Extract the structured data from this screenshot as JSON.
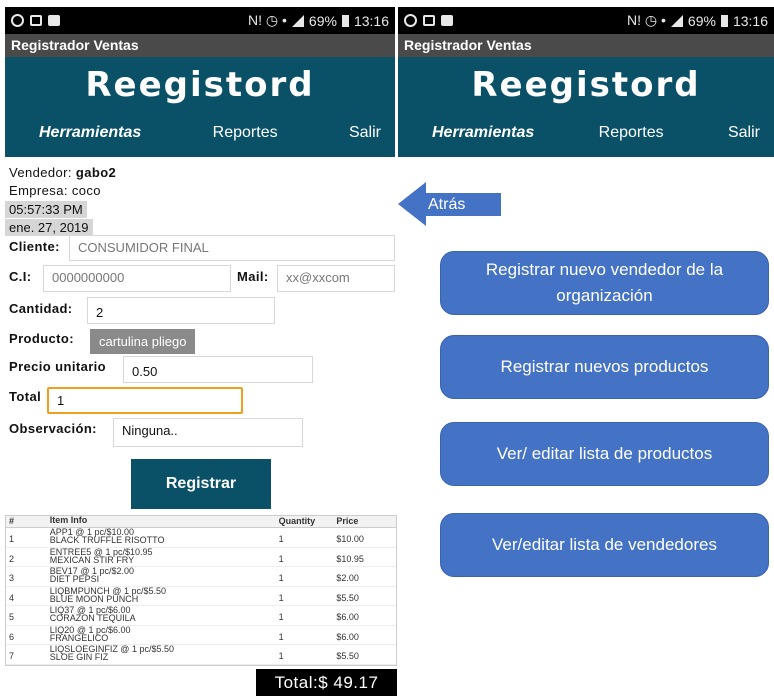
{
  "status": {
    "left_icons": [
      "whatsapp-icon",
      "gallery-icon",
      "mail-icon"
    ],
    "right_icons": "N! ◷ •",
    "battery": "69%",
    "time": "13:16"
  },
  "app": {
    "name": "Registrador Ventas",
    "title": "Reegistord"
  },
  "nav": [
    "Herramientas",
    "Reportes",
    "Salir"
  ],
  "form": {
    "vendedor_label": "Vendedor:",
    "vendedor": "gabo2",
    "empresa": "Empresa: coco",
    "time": "05:57:33 PM",
    "date": "ene. 27, 2019",
    "cliente_label": "Cliente:",
    "cliente": "CONSUMIDOR FINAL",
    "ci_label": "C.I:",
    "ci": "0000000000",
    "mail_label": "Mail:",
    "mail": "xx@xxcom",
    "cantidad_label": "Cantidad:",
    "cantidad": "2",
    "producto_label": "Producto:",
    "producto": "cartulina pliego",
    "precio_label": "Precio unitario",
    "precio": "0.50",
    "total_label": "Total",
    "total": "1",
    "obs_label": "Observación:",
    "obs": "Ninguna..",
    "submit": "Registrar"
  },
  "receipt": {
    "headers": [
      "#",
      "Item Info",
      "Quantity",
      "Price"
    ],
    "rows": [
      [
        "1",
        "APP1 @ 1 pc/$10.00",
        "BLACK TRUFFLE RISOTTO",
        "1",
        "$10.00"
      ],
      [
        "2",
        "ENTREE5 @ 1 pc/$10.95",
        "MEXICAN STIR FRY",
        "1",
        "$10.95"
      ],
      [
        "3",
        "BEV17 @ 1 pc/$2.00",
        "DIET PEPSI",
        "1",
        "$2.00"
      ],
      [
        "4",
        "LIQBMPUNCH @ 1 pc/$5.50",
        "BLUE MOON PUNCH",
        "1",
        "$5.50"
      ],
      [
        "5",
        "LIQ37 @ 1 pc/$6.00",
        "CORAZON TEQUILA",
        "1",
        "$6.00"
      ],
      [
        "6",
        "LIQ20 @ 1 pc/$6.00",
        "FRANGELICO",
        "1",
        "$6.00"
      ],
      [
        "7",
        "LIQSLOEGINFIZ @ 1 pc/$5.50",
        "SLOE GIN FIZ",
        "1",
        "$5.50"
      ]
    ],
    "total": "Total:$ 49.17"
  },
  "menu": {
    "back": "Atrás",
    "buttons": [
      "Registrar nuevo vendedor de la organización",
      "Registrar nuevos productos",
      "Ver/ editar lista de productos",
      "Ver/editar lista de vendedores"
    ]
  },
  "colors": {
    "brand": "#0a5168",
    "accent": "#4472c4",
    "focus": "#f0a020"
  }
}
